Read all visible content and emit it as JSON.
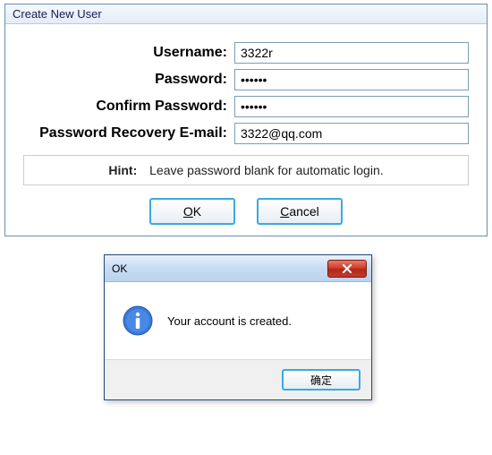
{
  "mainDialog": {
    "title": "Create New User",
    "fields": {
      "usernameLabel": "Username:",
      "usernameValue": "3322r",
      "passwordLabel": "Password:",
      "passwordValue": "••••••",
      "confirmLabel": "Confirm Password:",
      "confirmValue": "••••••",
      "emailLabel": "Password Recovery E-mail:",
      "emailValue": "3322@qq.com"
    },
    "hintLabel": "Hint:",
    "hintText": "Leave password blank for automatic login.",
    "buttons": {
      "okPrefix": "O",
      "okRest": "K",
      "cancelPrefix": "C",
      "cancelRest": "ancel"
    }
  },
  "infoDialog": {
    "title": "OK",
    "message": "Your account is created.",
    "okLabel": "确定"
  }
}
